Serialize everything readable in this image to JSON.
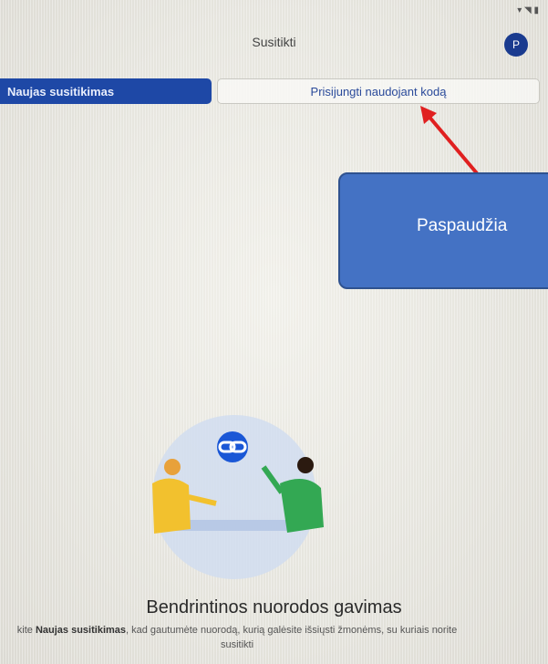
{
  "status_bar": {
    "icons": "wifi-signal-battery"
  },
  "header": {
    "title": "Susitikti",
    "avatar_initial": "P"
  },
  "actions": {
    "new_meeting_label": "Naujas susitikimas",
    "join_code_label": "Prisijungti naudojant kodą"
  },
  "annotation": {
    "callout_text": "Paspaudžia",
    "color": "#4472c4",
    "arrow_color": "#e02020"
  },
  "content": {
    "heading": "Bendrintinos nuorodos gavimas",
    "desc_prefix": "kite ",
    "desc_bold": "Naujas susitikimas",
    "desc_rest": ", kad gautumėte nuorodą, kurią galėsite išsiųsti žmonėms, su kuriais norite susitikti",
    "link_icon": "link-icon"
  }
}
